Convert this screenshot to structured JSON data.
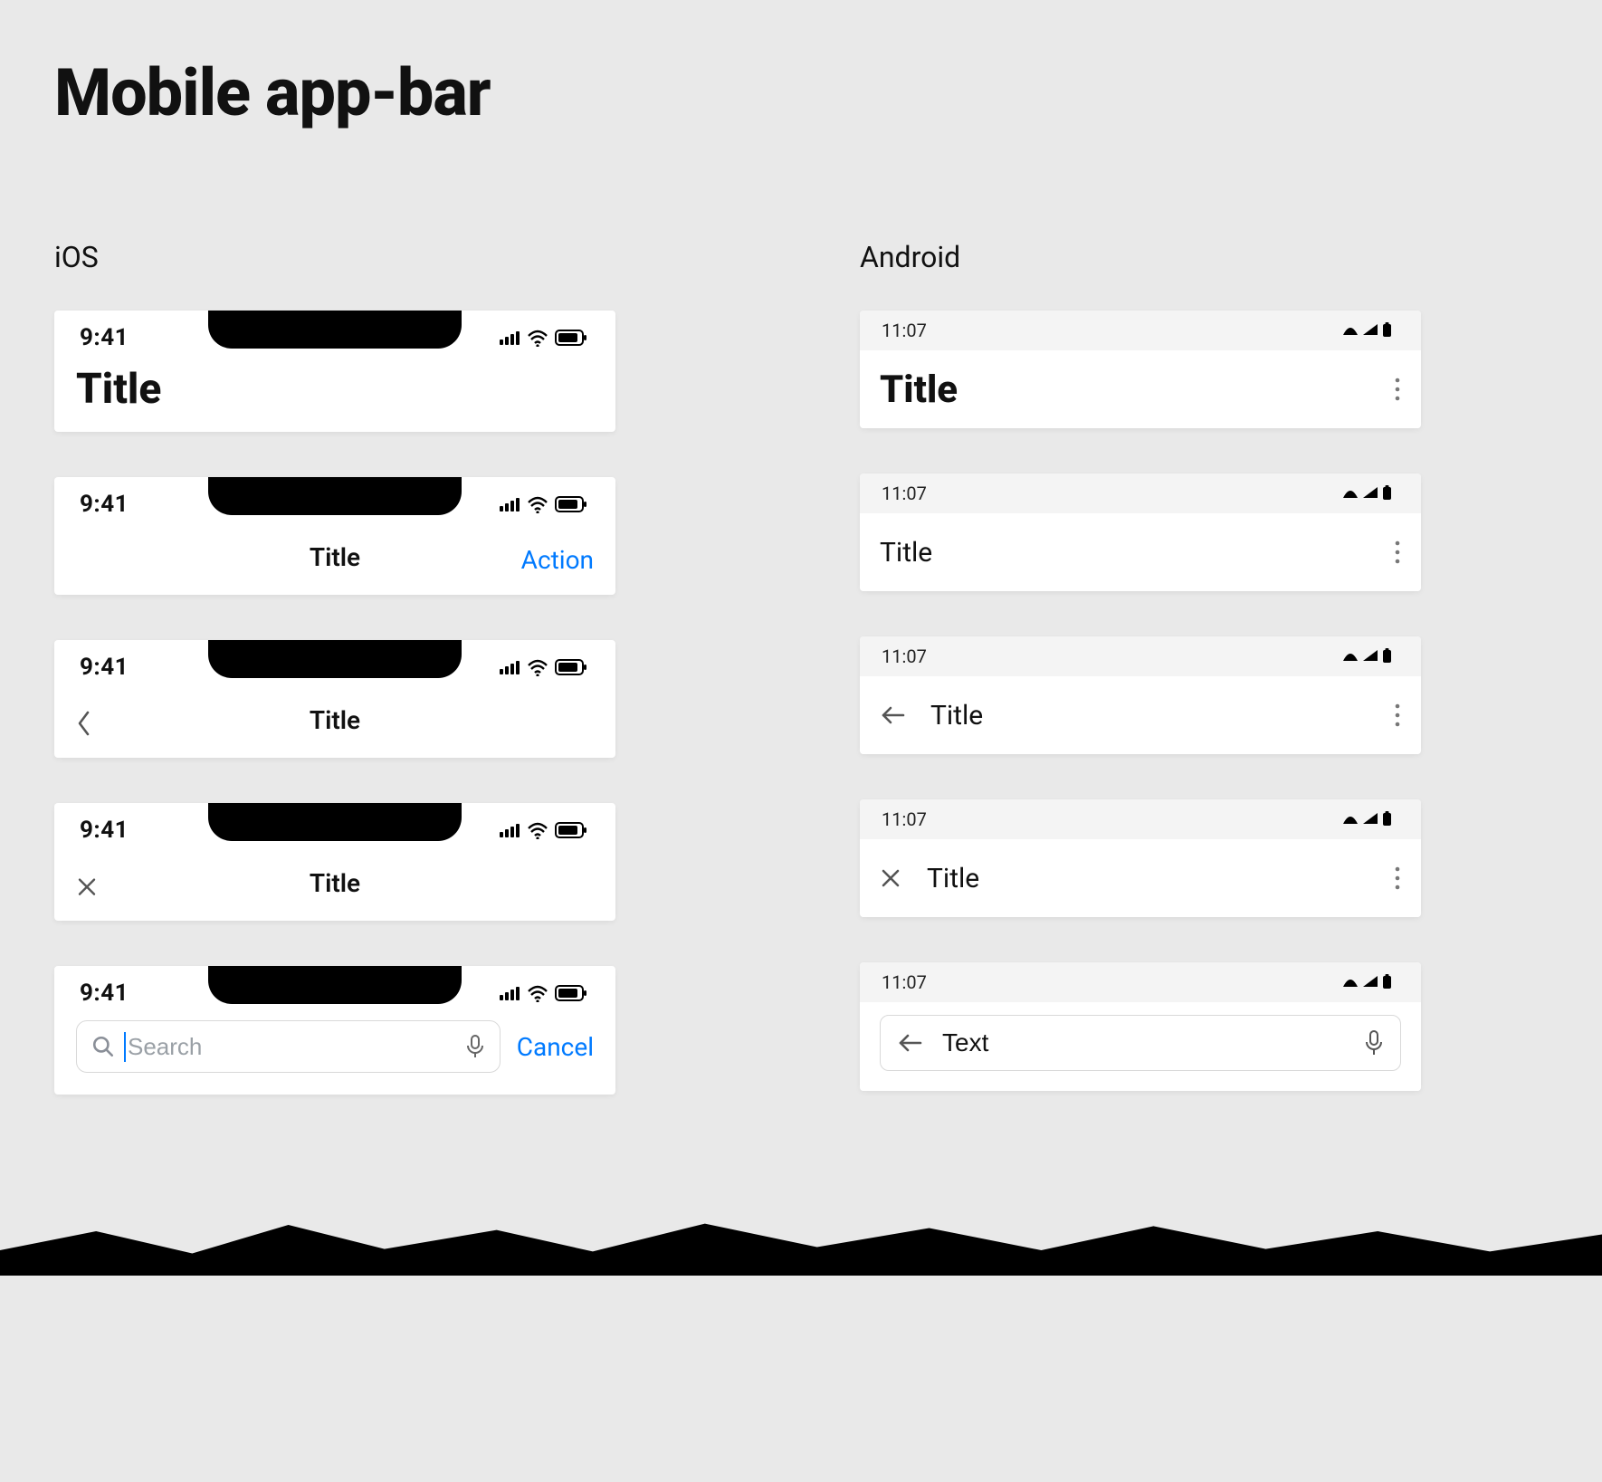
{
  "page_title": "Mobile app-bar",
  "columns": {
    "ios": "iOS",
    "android": "Android"
  },
  "ios": {
    "status_time": "9:41",
    "large_title": "Title",
    "center_title": "Title",
    "action_label": "Action",
    "cancel_label": "Cancel",
    "search_placeholder": "Search"
  },
  "android": {
    "status_time": "11:07",
    "large_title": "Title",
    "regular_title": "Title",
    "search_value": "Text"
  }
}
